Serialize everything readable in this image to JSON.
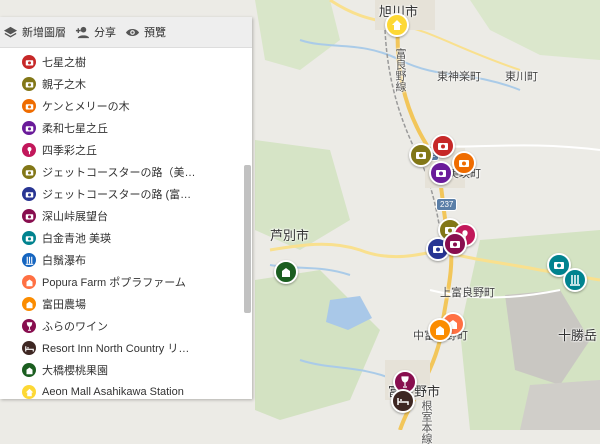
{
  "toolbar": {
    "add_layer_label": "新增圖層",
    "share_label": "分享",
    "preview_label": "預覽"
  },
  "layer_items": [
    {
      "label": "七星之樹",
      "icon": "camera-icon",
      "color": "#c62828"
    },
    {
      "label": "親子之木",
      "icon": "camera-icon",
      "color": "#827717"
    },
    {
      "label": "ケンとメリーの木",
      "icon": "camera-icon",
      "color": "#ef6c00"
    },
    {
      "label": "柔和七星之丘",
      "icon": "camera-icon",
      "color": "#6a1b9a"
    },
    {
      "label": "四季彩之丘",
      "icon": "flower-icon",
      "color": "#c2185b"
    },
    {
      "label": "ジェットコースターの路（美…",
      "icon": "camera-icon",
      "color": "#827717"
    },
    {
      "label": "ジェットコースターの路 (富…",
      "icon": "camera-icon",
      "color": "#283593"
    },
    {
      "label": "深山峠展望台",
      "icon": "camera-icon",
      "color": "#880e4f"
    },
    {
      "label": "白金青池 美瑛",
      "icon": "camera-icon",
      "color": "#00838f"
    },
    {
      "label": "白鬚瀑布",
      "icon": "waterfall-icon",
      "color": "#1565c0"
    },
    {
      "label": "Popura Farm ポプラファーム",
      "icon": "farm-icon",
      "color": "#ff7043"
    },
    {
      "label": "富田農場",
      "icon": "farm-icon",
      "color": "#fb8c00"
    },
    {
      "label": "ふらのワイン",
      "icon": "wine-icon",
      "color": "#880e4f"
    },
    {
      "label": "Resort Inn North Country リ…",
      "icon": "bed-icon",
      "color": "#3e2723"
    },
    {
      "label": "大橋櫻桃果園",
      "icon": "farm-icon",
      "color": "#1b5e20"
    },
    {
      "label": "Aeon Mall Asahikawa Station",
      "icon": "home-icon",
      "color": "#fdd835"
    }
  ],
  "map_labels": {
    "asahikawa": "旭川市",
    "higashikagura": "東神楽町",
    "higashikawa": "東川町",
    "ashibetsu": "芦別市",
    "kamifurano": "上富良野町",
    "tokachidake": "十勝岳",
    "biei_partial": "美瑛町",
    "nakafurano_partial": "中富良野町",
    "furano_partial": "富良野市",
    "line_furano": "富良野線",
    "line_nemuro": "根室本線",
    "route_452": "452",
    "route_237": "237"
  }
}
